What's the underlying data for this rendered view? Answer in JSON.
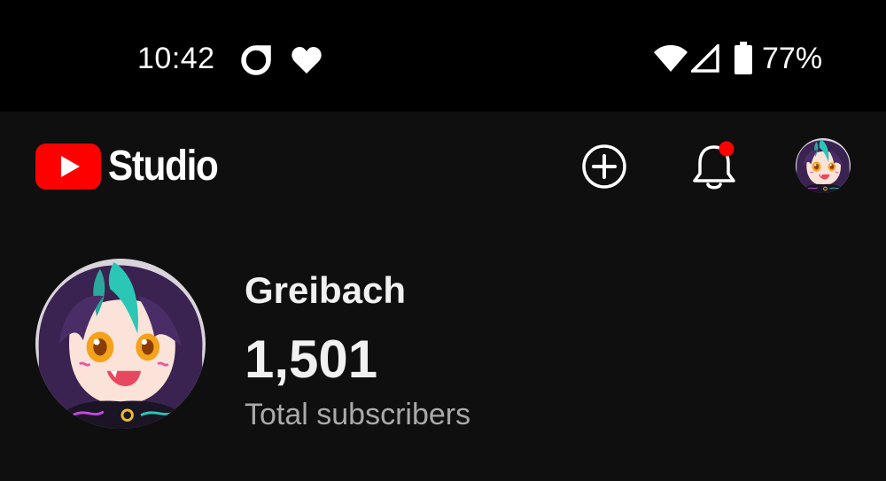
{
  "status_bar": {
    "time": "10:42",
    "battery_percent": "77%",
    "icons": [
      "circle-status-icon",
      "heart-icon",
      "wifi-icon",
      "cell-signal-icon",
      "battery-icon"
    ]
  },
  "app_bar": {
    "logo_text": "Studio",
    "logo_icon": "youtube-play-icon",
    "create_icon": "add-circle-icon",
    "notifications_icon": "bell-icon",
    "has_unread_notifications": true,
    "account_icon": "avatar"
  },
  "channel": {
    "name": "Greibach",
    "subscriber_count": "1,501",
    "subscriber_label": "Total subscribers"
  },
  "colors": {
    "background": "#0f0f0f",
    "status_bar": "#000000",
    "youtube_red": "#ff0000",
    "notification_dot": "#ff0000",
    "primary_text": "#f1f1f1",
    "secondary_text": "#aaaaaa"
  }
}
